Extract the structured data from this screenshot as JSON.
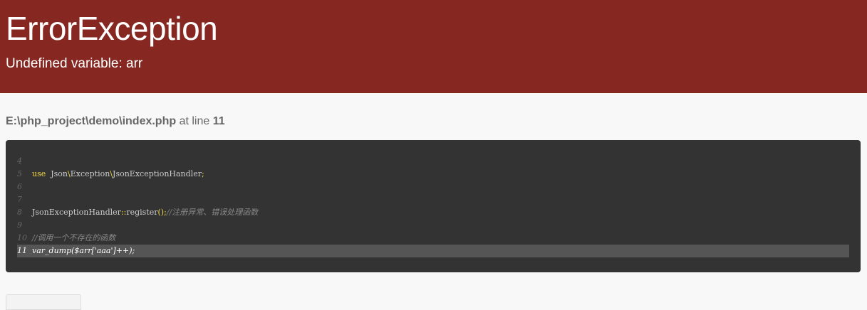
{
  "error": {
    "title": "ErrorException",
    "message": "Undefined variable: arr"
  },
  "location": {
    "file": "E:\\php_project\\demo\\index.php",
    "at_line_text": "at line",
    "line": "11"
  },
  "code": [
    {
      "num": "4",
      "parts": [],
      "highlight": false
    },
    {
      "num": "5",
      "parts": [
        {
          "t": "use",
          "c": "kw"
        },
        {
          "t": "  Json",
          "c": ""
        },
        {
          "t": "\\",
          "c": "pn"
        },
        {
          "t": "Exception",
          "c": ""
        },
        {
          "t": "\\",
          "c": "pn"
        },
        {
          "t": "JsonExceptionHandler",
          "c": ""
        },
        {
          "t": ";",
          "c": "pn"
        }
      ],
      "highlight": false
    },
    {
      "num": "6",
      "parts": [],
      "highlight": false
    },
    {
      "num": "7",
      "parts": [],
      "highlight": false
    },
    {
      "num": "8",
      "parts": [
        {
          "t": "JsonExceptionHandler",
          "c": ""
        },
        {
          "t": "::",
          "c": "pn"
        },
        {
          "t": "register",
          "c": ""
        },
        {
          "t": "();",
          "c": "pn"
        },
        {
          "t": "//注册异常、错误处理函数",
          "c": "cm"
        }
      ],
      "highlight": false
    },
    {
      "num": "9",
      "parts": [],
      "highlight": false
    },
    {
      "num": "10",
      "parts": [
        {
          "t": "//调用一个不存在的函数",
          "c": "cm"
        }
      ],
      "highlight": false
    },
    {
      "num": "11",
      "parts": [
        {
          "t": "var_dump($arr['aaa']++);",
          "c": ""
        }
      ],
      "highlight": true
    }
  ],
  "colors": {
    "header_bg": "#862721",
    "code_bg": "#333333",
    "highlight_bg": "#555555"
  }
}
